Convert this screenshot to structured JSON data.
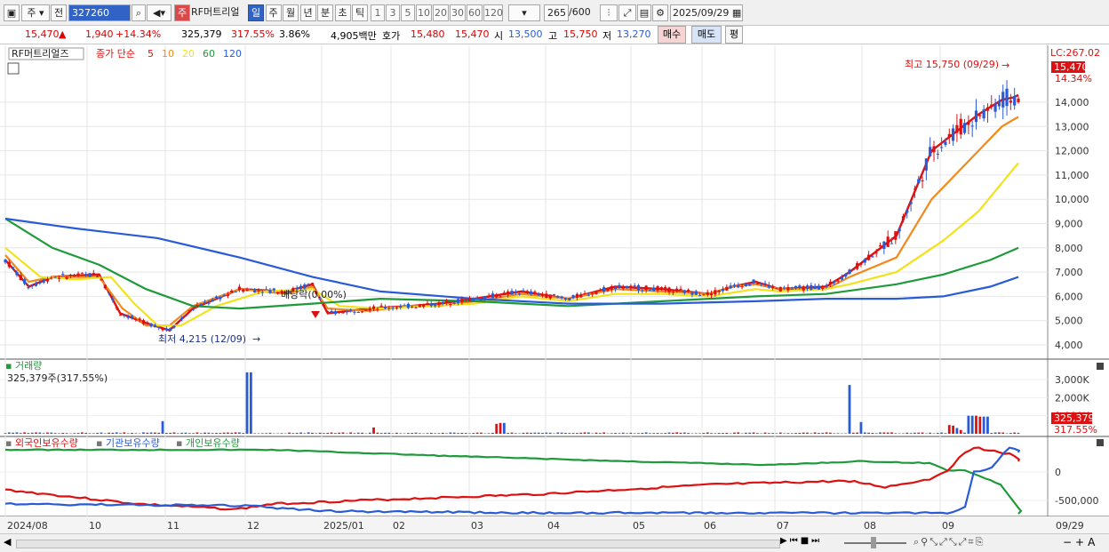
{
  "toolbar": {
    "menu1": "주",
    "menu2": "전",
    "code": "327260",
    "stock_type": "주",
    "stock_name": "RF머트리얼",
    "period_tabs": [
      "일",
      "주",
      "월",
      "년",
      "분",
      "초",
      "틱"
    ],
    "period_selected": "일",
    "minute_tabs": [
      "1",
      "3",
      "5",
      "10",
      "20",
      "30",
      "60",
      "120"
    ],
    "count": "265",
    "count_max": "/600",
    "date": "2025/09/29"
  },
  "quote": {
    "price": "15,470",
    "change_arrow": "▲",
    "change": "1,940",
    "change_pct": "+14.34%",
    "volume": "325,379",
    "volume_pct": "317.55%",
    "turnover": "3.86%",
    "amount": "4,905백만",
    "hoga_label": "호가",
    "ask": "15,480",
    "bid": "15,470",
    "open_label": "시",
    "open": "13,500",
    "high_label": "고",
    "high": "15,750",
    "low_label": "저",
    "low": "13,270",
    "buy_button": "매수",
    "sell_button": "매도",
    "eval_button": "평"
  },
  "price_panel": {
    "legend_name": "RF머트리얼즈",
    "legend_ma_label": "종가 단순",
    "ma_periods": [
      "5",
      "10",
      "20",
      "60",
      "120"
    ],
    "ma_colors": [
      "#dd1111",
      "#f08a1c",
      "#f2e21a",
      "#1f9a3b",
      "#2a5bd7"
    ],
    "lc": "LC:267.02",
    "price_tag": "15,470",
    "pct_tag": "14.34%",
    "max_annot": "최고 15,750 (09/29)",
    "min_annot": "최저 4,215 (12/09)",
    "dividend_annot": "배당락(0.00%)",
    "y_ticks": [
      "14,000",
      "13,000",
      "12,000",
      "11,000",
      "10,000",
      "9,000",
      "8,000",
      "7,000",
      "6,000",
      "5,000",
      "4,000"
    ]
  },
  "volume_panel": {
    "title": "거래량",
    "value_label": "325,379주(317.55%)",
    "y_ticks": [
      "3,000K",
      "2,000K",
      "1,000K"
    ],
    "tag_volume": "325,379",
    "tag_pct": "317.55%"
  },
  "holding_panel": {
    "legends": [
      "외국인보유수량",
      "기관보유수량",
      "개인보유수량"
    ],
    "legend_colors": [
      "#dd1111",
      "#2a5bd7",
      "#1f9a3b"
    ],
    "y_ticks": [
      "0",
      "-500,000"
    ]
  },
  "x_axis": {
    "labels": [
      "2024/08",
      "10",
      "11",
      "12",
      "2025/01",
      "02",
      "03",
      "04",
      "05",
      "06",
      "07",
      "08",
      "09"
    ],
    "right_label": "09/29"
  },
  "bottombar": {
    "controls": [
      "◀",
      "▶",
      "⏮",
      "■",
      "⏭"
    ],
    "tools": [
      "+",
      "−",
      "A"
    ]
  }
}
